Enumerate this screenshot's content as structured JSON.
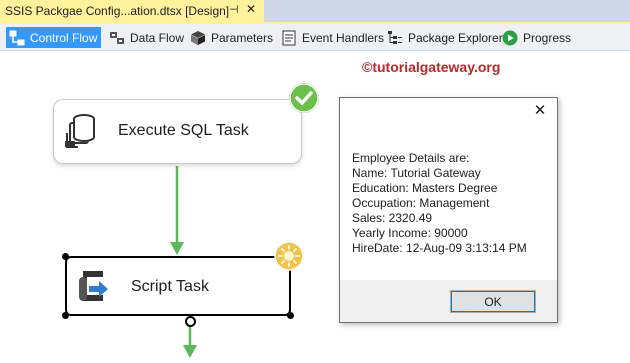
{
  "document_tab": {
    "title": "SSIS Packgae Config...ation.dtsx [Design]",
    "pin_icon": "pin-icon",
    "close_icon": "close-icon"
  },
  "designer_tabs": [
    {
      "label": "Control Flow",
      "icon": "control-flow-icon",
      "active": true
    },
    {
      "label": "Data Flow",
      "icon": "data-flow-icon",
      "active": false
    },
    {
      "label": "Parameters",
      "icon": "parameters-icon",
      "active": false
    },
    {
      "label": "Event Handlers",
      "icon": "event-handlers-icon",
      "active": false
    },
    {
      "label": "Package Explorer",
      "icon": "package-explorer-icon",
      "active": false
    },
    {
      "label": "Progress",
      "icon": "progress-icon",
      "active": false
    }
  ],
  "watermark": "©tutorialgateway.org",
  "tasks": {
    "execute_sql": {
      "label": "Execute SQL Task",
      "status": "success"
    },
    "script": {
      "label": "Script Task",
      "status": "running"
    }
  },
  "dialog": {
    "lines": [
      "Employee Details are:",
      "Name: Tutorial Gateway",
      "Education: Masters Degree",
      "Occupation: Management",
      "Sales: 2320.49",
      "Yearly Income: 90000",
      "HireDate: 12-Aug-09 3:13:14 PM"
    ],
    "ok_label": "OK",
    "close_symbol": "✕"
  },
  "colors": {
    "tab_active": "#fff29d",
    "designer_active": "#3399ff",
    "precedence_arrow": "#5cb85c",
    "success_badge": "#6cc04a",
    "running_badge": "#f2c14e",
    "watermark": "#b52a2a"
  }
}
